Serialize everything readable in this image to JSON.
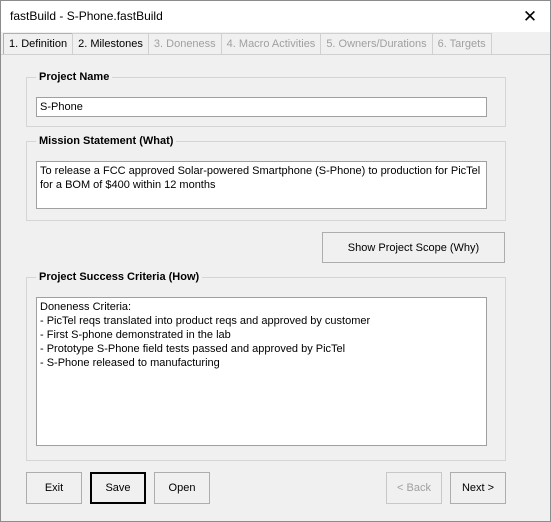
{
  "window": {
    "title": "fastBuild - S-Phone.fastBuild",
    "close_glyph": "✕"
  },
  "tabs": [
    {
      "label": "1. Definition",
      "enabled": true
    },
    {
      "label": "2. Milestones",
      "enabled": true
    },
    {
      "label": "3. Doneness",
      "enabled": false
    },
    {
      "label": "4. Macro Activities",
      "enabled": false
    },
    {
      "label": "5. Owners/Durations",
      "enabled": false
    },
    {
      "label": "6. Targets",
      "enabled": false
    }
  ],
  "project_name": {
    "legend": "Project Name",
    "value": "S-Phone"
  },
  "mission": {
    "legend": "Mission Statement (What)",
    "value": "To release a FCC approved Solar-powered Smartphone (S-Phone) to production for PicTel for a BOM of $400 within 12 months"
  },
  "scope_button": {
    "label": "Show Project Scope (Why)"
  },
  "success": {
    "legend": "Project Success Criteria (How)",
    "value": "Doneness Criteria:\n- PicTel reqs translated into product reqs and approved by customer\n- First S-phone demonstrated in the lab\n- Prototype S-Phone field tests passed and approved by PicTel\n- S-Phone released to manufacturing"
  },
  "footer": {
    "exit_label": "Exit",
    "save_label": "Save",
    "open_label": "Open",
    "back_label": "< Back",
    "next_label": "Next >"
  }
}
